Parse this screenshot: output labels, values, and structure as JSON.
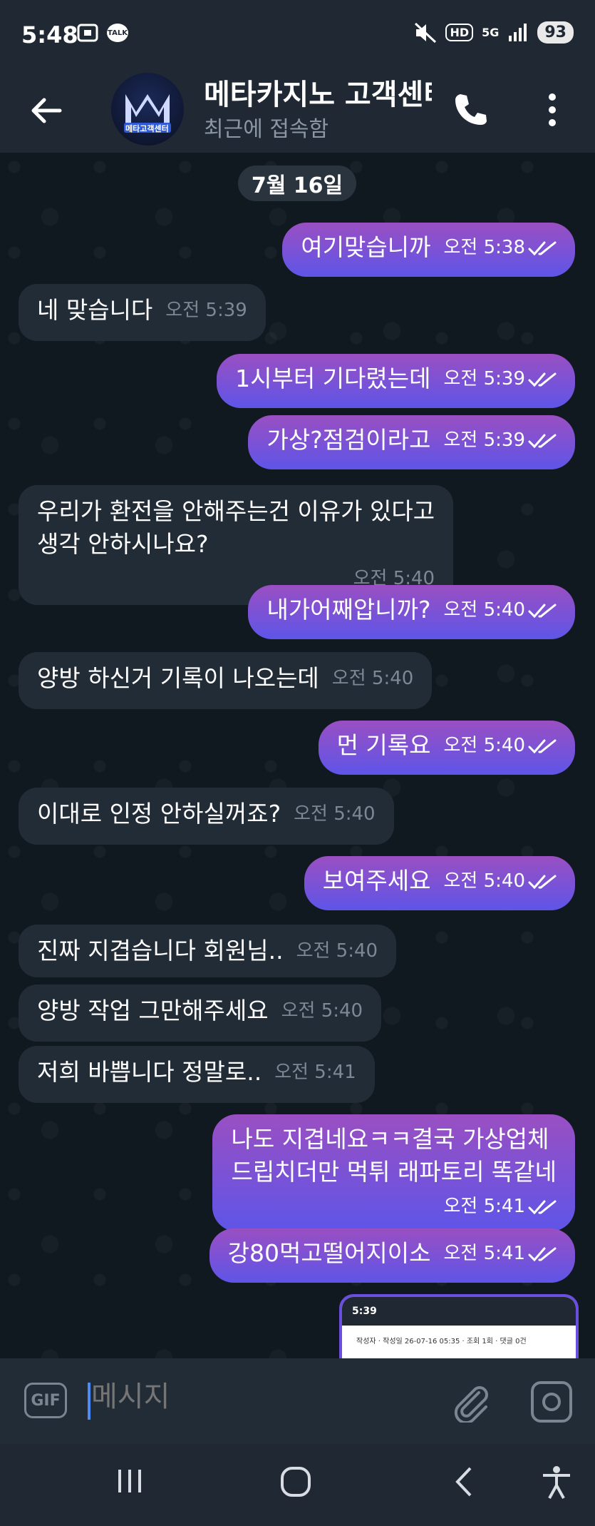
{
  "status_bar": {
    "time": "5:48",
    "talk_label": "TALK",
    "hd_label": "HD",
    "network": "5G",
    "battery": "93"
  },
  "header": {
    "title": "메타카지노 고객센터",
    "subtitle": "최근에 접속함",
    "avatar_text": "메타고객센터"
  },
  "chat": {
    "date": "7월 16일",
    "messages": [
      {
        "dir": "out",
        "text": "여기맞습니까",
        "time": "오전 5:38"
      },
      {
        "dir": "in",
        "text": "네 맞습니다",
        "time": "오전 5:39"
      },
      {
        "dir": "out",
        "text": "1시부터 기다렸는데",
        "time": "오전 5:39"
      },
      {
        "dir": "out",
        "text": "가상?점검이라고",
        "time": "오전 5:39"
      },
      {
        "dir": "in",
        "text": "우리가 환전을 안해주는건 이유가 있다고\n생각 안하시나요?",
        "time": "오전 5:40"
      },
      {
        "dir": "out",
        "text": "내가어째압니까?",
        "time": "오전 5:40"
      },
      {
        "dir": "in",
        "text": "양방 하신거 기록이 나오는데",
        "time": "오전 5:40"
      },
      {
        "dir": "out",
        "text": "먼 기록요",
        "time": "오전 5:40"
      },
      {
        "dir": "in",
        "text": "이대로 인정 안하실꺼죠?",
        "time": "오전 5:40"
      },
      {
        "dir": "out",
        "text": "보여주세요",
        "time": "오전 5:40"
      },
      {
        "dir": "in",
        "text": "진짜 지겹습니다 회원님..",
        "time": "오전 5:40"
      },
      {
        "dir": "in",
        "text": "양방 작업 그만해주세요",
        "time": "오전 5:40"
      },
      {
        "dir": "in",
        "text": "저희 바쁩니다 정말로..",
        "time": "오전 5:41"
      },
      {
        "dir": "out",
        "text": "나도 지겹네요ㅋㅋ결국 가상업체\n드립치더만 먹튀 래파토리 똑같네",
        "time": "오전 5:41"
      },
      {
        "dir": "out",
        "text": "강80먹고떨어지이소",
        "time": "오전 5:41"
      }
    ],
    "thumbnail": {
      "time": "5:39",
      "line": "작성자 · 작성일 26-07-16 05:35 · 조회 1회 · 댓글 0건"
    }
  },
  "input": {
    "gif_label": "GIF",
    "placeholder": "메시지"
  },
  "colors": {
    "out_top": "#9a4fc2",
    "out_bottom": "#5e55e8",
    "incoming": "#222c37",
    "bg": "#101820"
  }
}
